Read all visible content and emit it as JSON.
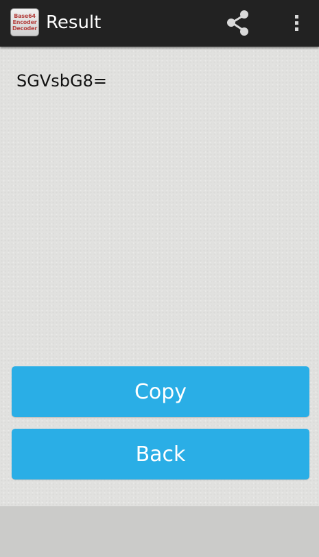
{
  "action_bar": {
    "app_icon_text": [
      "Base64",
      "Encoder",
      "Decoder"
    ],
    "title": "Result",
    "share_icon": "share-icon",
    "menu_icon": "overflow-menu-icon"
  },
  "result": {
    "text": "SGVsbG8="
  },
  "buttons": {
    "copy_label": "Copy",
    "back_label": "Back"
  },
  "colors": {
    "action_bar": "#222222",
    "button": "#2aaee6",
    "background": "#e1e1df"
  }
}
